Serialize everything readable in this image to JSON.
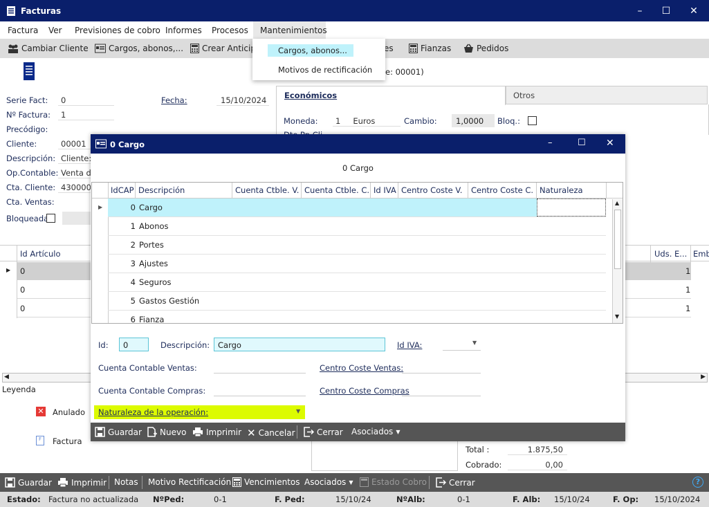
{
  "window": {
    "title": "Facturas"
  },
  "menu": [
    "Factura",
    "Ver",
    "Previsiones de cobro",
    "Informes",
    "Procesos",
    "Mantenimientos"
  ],
  "toolbar": {
    "cambiar_cliente": "Cambiar Cliente",
    "cargos": "Cargos, abonos,...",
    "crear_anticipo": "Crear Anticipo",
    "es": "es",
    "fianzas": "Fianzas",
    "pedidos": "Pedidos"
  },
  "dropdown": {
    "item1": "Cargos, abonos...",
    "item2": "Motivos de rectificación"
  },
  "form": {
    "serie_lbl": "Serie Fact:",
    "serie_val": "0",
    "nfactura_lbl": "Nº Factura:",
    "nfactura_val": "1",
    "precodigo_lbl": "Precódigo:",
    "cliente_lbl": "Cliente:",
    "cliente_val": "00001",
    "descripcion_lbl": "Descripción:",
    "descripcion_val": "Cliente:",
    "opcontable_lbl": "Op.Contable:",
    "opcontable_val": "Venta de",
    "ctacliente_lbl": "Cta. Cliente:",
    "ctacliente_val": "430000",
    "ctaventas_lbl": "Cta. Ventas:",
    "bloqueada_lbl": "Bloqueada",
    "fecha_lbl": "Fecha:",
    "fecha_val": "15/10/2024",
    "ref_partial": "e: 00001)"
  },
  "tabs": {
    "economicos": "Económicos",
    "otros": "Otros"
  },
  "eco": {
    "moneda_lbl": "Moneda:",
    "moneda_num": "1",
    "moneda_val": "Euros",
    "cambio_lbl": "Cambio:",
    "cambio_val": "1,0000",
    "bloq_lbl": "Bloq.:",
    "partial": "Dto.Pp Cli"
  },
  "lines": {
    "col_id": "Id Artículo",
    "col_uds": "Uds. E...",
    "col_emb": "Emb",
    "rows": [
      {
        "id": "0",
        "uds": "1"
      },
      {
        "id": "0",
        "uds": "1"
      },
      {
        "id": "0",
        "uds": "1"
      }
    ]
  },
  "legend": {
    "title": "Leyenda",
    "anulado": "Anulado",
    "factura": "Factura"
  },
  "totals": {
    "total_lbl": "Total :",
    "total_val": "1.875,50",
    "cobrado_lbl": "Cobrado:",
    "cobrado_val": "0,00"
  },
  "dialog": {
    "title": "0 Cargo",
    "subtitle": "0 Cargo",
    "columns": [
      "IdCAP",
      "Descripción",
      "Cuenta Ctble. V.",
      "Cuenta Ctble. C.",
      "Id IVA",
      "Centro Coste V.",
      "Centro Coste C.",
      "Naturaleza"
    ],
    "rows": [
      {
        "id": "0",
        "desc": "Cargo"
      },
      {
        "id": "1",
        "desc": "Abonos"
      },
      {
        "id": "2",
        "desc": "Portes"
      },
      {
        "id": "3",
        "desc": "Ajustes"
      },
      {
        "id": "4",
        "desc": "Seguros"
      },
      {
        "id": "5",
        "desc": "Gastos Gestión"
      },
      {
        "id": "6",
        "desc": "Fianza"
      }
    ],
    "id_lbl": "Id:",
    "id_val": "0",
    "desc_lbl": "Descripción:",
    "desc_val": "Cargo",
    "idiva_lbl": "Id IVA:",
    "ccv_lbl": "Cuenta Contable Ventas:",
    "ccc_lbl": "Cuenta Contable Compras:",
    "cctv_lbl": "Centro Coste Ventas:",
    "cctc_lbl": "Centro Coste Compras",
    "nat_lbl": "Naturaleza de la operación:",
    "buttons": {
      "guardar": "Guardar",
      "nuevo": "Nuevo",
      "imprimir": "Imprimir",
      "cancelar": "Cancelar",
      "cerrar": "Cerrar",
      "asociados": "Asociados"
    }
  },
  "bottombar": {
    "guardar": "Guardar",
    "imprimir": "Imprimir",
    "notas": "Notas",
    "motivo": "Motivo Rectificación",
    "vencimientos": "Vencimientos",
    "asociados": "Asociados",
    "estado_cobro": "Estado Cobro",
    "cerrar": "Cerrar"
  },
  "status": {
    "estado_lbl": "Estado:",
    "estado_val": "Factura no actualizada",
    "nped_lbl": "NºPed:",
    "nped_val": "0-1",
    "fped_lbl": "F. Ped:",
    "fped_val": "15/10/24",
    "nalb_lbl": "NºAlb:",
    "nalb_val": "0-1",
    "falb_lbl": "F. Alb:",
    "falb_val": "15/10/24",
    "fop_lbl": "F. Op:",
    "fop_val": "15/10/2024"
  },
  "colors": {
    "titlebar": "#0a1f6b",
    "selected_row": "#bff2fb",
    "highlight": "#dcfb00"
  }
}
